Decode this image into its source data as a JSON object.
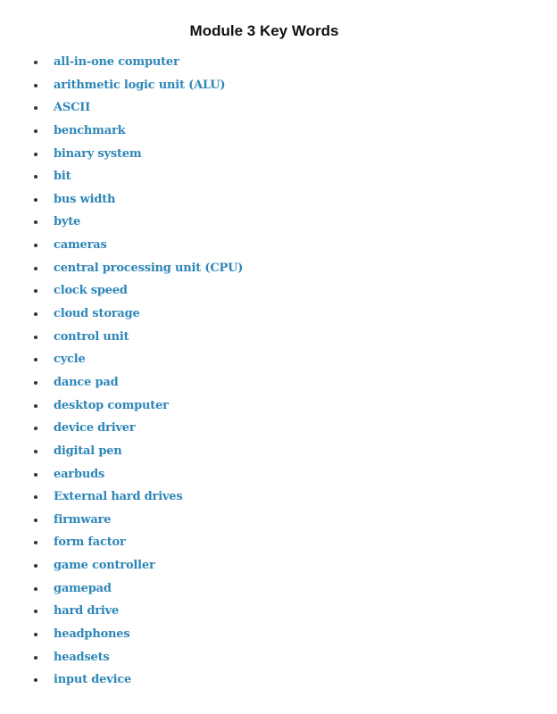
{
  "document": {
    "title": "Module 3 Key Words",
    "accent_color": "#2e86b8",
    "terms": [
      "all-in-one computer",
      "arithmetic logic unit (ALU)",
      "ASCII",
      "benchmark",
      "binary system",
      "bit",
      "bus width",
      "byte",
      "cameras",
      "central processing unit (CPU)",
      "clock speed",
      "cloud storage",
      "control unit",
      "cycle",
      "dance pad",
      "desktop computer",
      "device driver",
      "digital pen",
      "earbuds",
      "External hard drives",
      "firmware",
      "form factor",
      "game controller",
      "gamepad",
      "hard drive",
      "headphones",
      "headsets",
      "input device"
    ]
  }
}
